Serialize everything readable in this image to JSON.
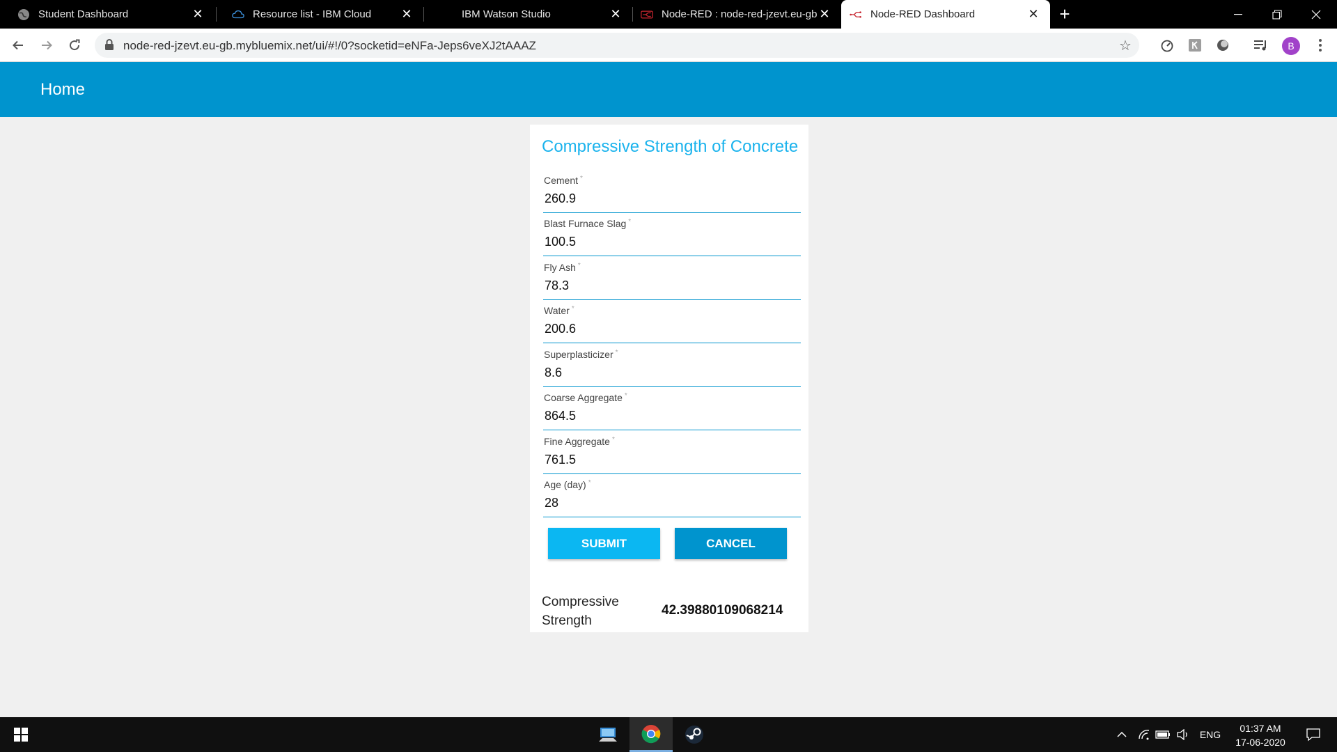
{
  "browser": {
    "tabs": [
      {
        "title": "Student Dashboard",
        "icon": "globe-icon"
      },
      {
        "title": "Resource list - IBM Cloud",
        "icon": "ibm-cloud-icon"
      },
      {
        "title": "IBM Watson Studio",
        "icon": "watson-icon"
      },
      {
        "title": "Node-RED : node-red-jzevt.eu-gb.mybluemix.net",
        "icon": "node-red-icon"
      },
      {
        "title": "Node-RED Dashboard",
        "icon": "node-red-icon",
        "active": true
      }
    ],
    "url": "node-red-jzevt.eu-gb.mybluemix.net/ui/#!/0?socketid=eNFa-Jeps6veXJ2tAAAZ",
    "profile_initial": "B"
  },
  "app": {
    "header_title": "Home",
    "card_title": "Compressive Strength of Concrete",
    "fields": [
      {
        "label": "Cement",
        "value": "260.9"
      },
      {
        "label": "Blast Furnace Slag",
        "value": "100.5"
      },
      {
        "label": "Fly Ash",
        "value": "78.3"
      },
      {
        "label": "Water",
        "value": "200.6"
      },
      {
        "label": "Superplasticizer",
        "value": "8.6"
      },
      {
        "label": "Coarse Aggregate",
        "value": "864.5"
      },
      {
        "label": "Fine Aggregate",
        "value": "761.5"
      },
      {
        "label": "Age (day)",
        "value": "28"
      }
    ],
    "required_mark": "*",
    "submit_label": "SUBMIT",
    "cancel_label": "CANCEL",
    "result_label": "Compressive Strength",
    "result_value": "42.39880109068214"
  },
  "taskbar": {
    "language": "ENG",
    "time": "01:37 AM",
    "date": "17-06-2020"
  },
  "colors": {
    "header_blue": "#0094ce",
    "title_blue": "#1bb3ed",
    "submit_blue": "#0bb7f2",
    "cancel_blue": "#0094ce"
  }
}
